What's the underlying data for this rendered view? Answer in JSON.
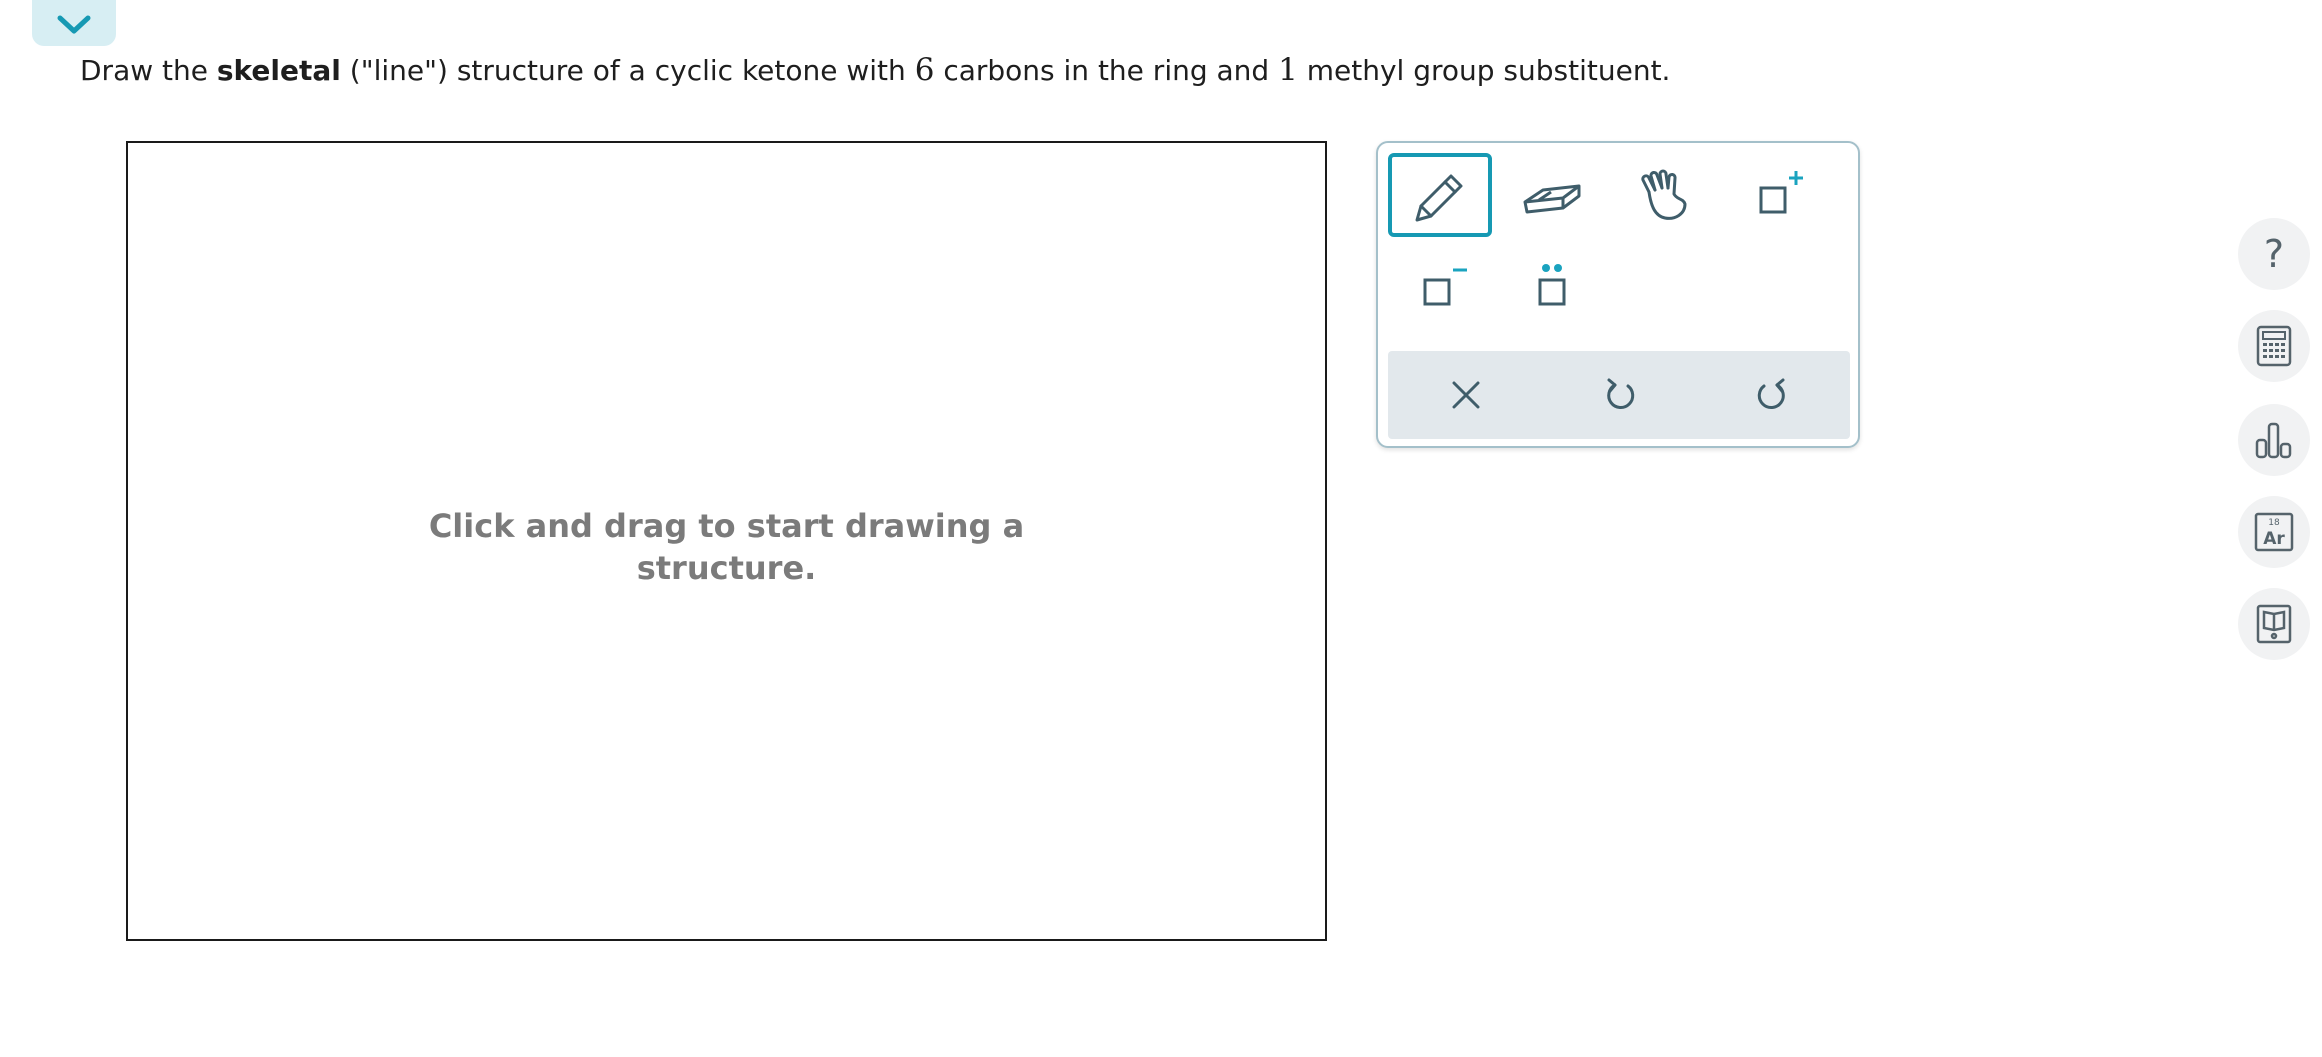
{
  "question": {
    "prefix": "Draw the ",
    "bold_term": "skeletal",
    "middle1": " (\"line\") structure of a cyclic ketone with ",
    "ring_count": "6",
    "middle2": " carbons in the ring and ",
    "methyl_count": "1",
    "suffix": " methyl group substituent."
  },
  "canvas": {
    "hint_line1": "Click and drag to start drawing a",
    "hint_line2": "structure."
  },
  "palette": {
    "tools": [
      {
        "icon": "pencil-icon",
        "active": true
      },
      {
        "icon": "eraser-icon",
        "active": false
      },
      {
        "icon": "hand-icon",
        "active": false
      },
      {
        "icon": "add-charge-icon",
        "active": false
      },
      {
        "icon": "remove-charge-icon",
        "active": false
      },
      {
        "icon": "lone-pair-icon",
        "active": false
      }
    ],
    "actions": [
      "clear-icon",
      "undo-icon",
      "redo-icon"
    ]
  },
  "side_tools": {
    "help": "?",
    "periodic_number": "18",
    "periodic_symbol": "Ar",
    "icons": [
      "help-icon",
      "calculator-icon",
      "chart-icon",
      "periodic-table-icon",
      "reference-book-icon"
    ]
  },
  "colors": {
    "accent": "#1699b3",
    "icon": "#3f5d6a",
    "charge": "#1aa3bf"
  }
}
